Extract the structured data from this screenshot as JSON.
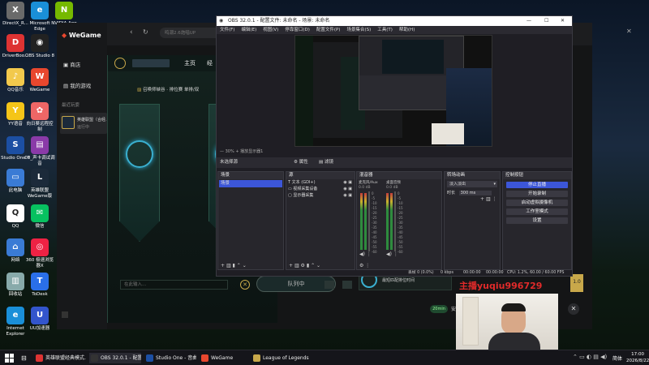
{
  "desktop": {
    "icons": [
      {
        "label": "DirectX_R...",
        "icon": "directx-icon",
        "color": "#6a6a6a",
        "glyph": "X"
      },
      {
        "label": "Microsoft Edge",
        "icon": "edge-icon",
        "color": "#1a8fd8",
        "glyph": "e"
      },
      {
        "label": "NVIDIA App",
        "icon": "nvidia-icon",
        "color": "#76b900",
        "glyph": "N"
      },
      {
        "label": "DriverBoo...",
        "icon": "driverbooster-icon",
        "color": "#d33",
        "glyph": "D"
      },
      {
        "label": "OBS Studio 8",
        "icon": "obs-icon",
        "color": "#222",
        "glyph": "◉"
      },
      {
        "label": "QQ音乐",
        "icon": "qqmusic-icon",
        "color": "#f2c94c",
        "glyph": "♪"
      },
      {
        "label": "WeGame",
        "icon": "wegame-icon",
        "color": "#e8472e",
        "glyph": "W"
      },
      {
        "label": "YY语音",
        "icon": "yy-icon",
        "color": "#f5c518",
        "glyph": "Y"
      },
      {
        "label": "向日葵远程控制",
        "icon": "sunflower-icon",
        "color": "#e66",
        "glyph": "✿"
      },
      {
        "label": "Studio One 7",
        "icon": "studioone-icon",
        "color": "#1c4fa3",
        "glyph": "S"
      },
      {
        "label": "00_声卡调试调音",
        "icon": "winrar-icon",
        "color": "#8a3aa8",
        "glyph": "▤"
      },
      {
        "label": "此电脑",
        "icon": "computer-icon",
        "color": "#3a7bd5",
        "glyph": "▭"
      },
      {
        "label": "英雄联盟WeGame版",
        "icon": "lol-icon",
        "color": "#1c2a3a",
        "glyph": "L"
      },
      {
        "label": "QQ",
        "icon": "qq-icon",
        "color": "#fff",
        "glyph": "Q"
      },
      {
        "label": "微信",
        "icon": "wechat-icon",
        "color": "#07c160",
        "glyph": "✉"
      },
      {
        "label": "网络",
        "icon": "network-icon",
        "color": "#3a7bd5",
        "glyph": "⌂"
      },
      {
        "label": "360 极速浏览器X",
        "icon": "360-icon",
        "color": "#e24",
        "glyph": "◎"
      },
      {
        "label": "回收站",
        "icon": "recycle-bin-icon",
        "color": "#8aa",
        "glyph": "▥"
      },
      {
        "label": "ToDesk",
        "icon": "todesk-icon",
        "color": "#2a6fe8",
        "glyph": "T"
      },
      {
        "label": "Internet Explorer",
        "icon": "ie-icon",
        "color": "#1a8fd8",
        "glyph": "e"
      },
      {
        "label": "UU加速器",
        "icon": "uu-icon",
        "color": "#3355cc",
        "glyph": "U"
      }
    ]
  },
  "wegame": {
    "brand": "WeGame",
    "search_placeholder": "鸣潮2.6炮唱UP",
    "side_items": [
      {
        "label": "商店"
      },
      {
        "label": "我的游戏"
      }
    ],
    "recent_label": "最近玩耍",
    "recent_game": "英雄联盟（合经...",
    "recent_game_status": "运行中",
    "lol_nav": [
      "主页",
      "经"
    ],
    "lol_mode": "召唤师峡谷 · 排位赛 单排/双",
    "chat_placeholder": "在此输入...",
    "queue_label": "队列中",
    "notice_text": "最短匹配排位时间",
    "version_badge": "1.0",
    "bottom_badge": "20min",
    "bottom_text": "安"
  },
  "obs": {
    "title": "OBS 32.0.1 - 配置文件: 未命名 - 场景: 未命名",
    "menu": [
      "文件(F)",
      "编辑(E)",
      "视图(V)",
      "停靠窗口(D)",
      "配置文件(P)",
      "场景集合(S)",
      "工具(T)",
      "帮助(H)"
    ],
    "zoom": "30%",
    "zoom_hint": "播放显示器1",
    "source_bar": {
      "selection": "未选择源",
      "properties": "属性",
      "filters": "滤镜"
    },
    "scenes": {
      "title": "场景",
      "items": [
        "场景"
      ]
    },
    "sources": {
      "title": "源",
      "items": [
        "文本 (GDI+)",
        "视频采集设备",
        "显示器采集"
      ]
    },
    "mixer": {
      "title": "混音器",
      "channels": [
        {
          "name": "麦克风/Aux",
          "db": "0.0 dB"
        },
        {
          "name": "桌面音频",
          "db": "0.0 dB"
        }
      ],
      "scale": [
        "0",
        "-5",
        "-10",
        "-15",
        "-20",
        "-25",
        "-30",
        "-35",
        "-40",
        "-45",
        "-50",
        "-55",
        "-60"
      ]
    },
    "transitions": {
      "title": "转场动画",
      "type": "淡入淡出",
      "duration_label": "时长",
      "duration": "300 ms"
    },
    "controls": {
      "title": "控制按钮",
      "buttons": [
        "停止直播",
        "开始录制",
        "启动虚拟摄像机",
        "工作室模式",
        "设置"
      ]
    },
    "status": {
      "dropped": "丢帧 0 (0.0%)",
      "kbps": "0 kbps",
      "live_time": "00:00:00",
      "rec_time": "00:00:00",
      "cpu": "CPU: 1.2%, 60.00 / 60.00 FPS"
    }
  },
  "overlay": {
    "text": "主播yuqiu996729"
  },
  "taskbar": {
    "items": [
      {
        "label": "英雄联盟经典模式...",
        "color": "#d33"
      },
      {
        "label": "OBS 32.0.1 - 配置...",
        "color": "#333"
      },
      {
        "label": "Studio One - 音曲...",
        "color": "#1c4fa3"
      },
      {
        "label": "WeGame",
        "color": "#e8472e"
      },
      {
        "label": "League of Legends",
        "color": "#c8a84a"
      }
    ],
    "ime": "简体",
    "time": "17:00",
    "date": "2026/8/22"
  }
}
